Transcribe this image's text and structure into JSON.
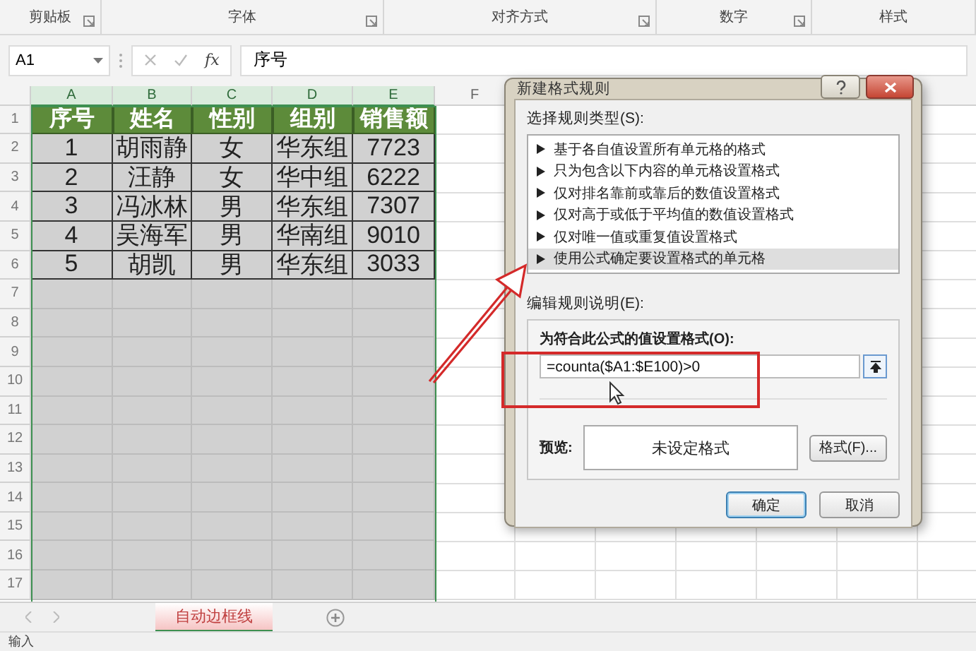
{
  "ribbon": {
    "groups": [
      {
        "label": "剪贴板"
      },
      {
        "label": "字体"
      },
      {
        "label": "对齐方式"
      },
      {
        "label": "数字"
      },
      {
        "label": "样式"
      }
    ]
  },
  "formula_bar": {
    "name_box": "A1",
    "function_label": "fx",
    "value": "序号"
  },
  "sheet": {
    "columns": [
      {
        "label": "A",
        "selected": true
      },
      {
        "label": "B",
        "selected": true
      },
      {
        "label": "C",
        "selected": true
      },
      {
        "label": "D",
        "selected": true
      },
      {
        "label": "E",
        "selected": true
      },
      {
        "label": "F",
        "selected": false
      }
    ],
    "row_numbers": [
      "1",
      "2",
      "3",
      "4",
      "5",
      "6",
      "7",
      "8",
      "9",
      "10",
      "11",
      "12",
      "13",
      "14",
      "15",
      "16",
      "17"
    ],
    "header": [
      "序号",
      "姓名",
      "性别",
      "组别",
      "销售额"
    ],
    "rows": [
      [
        "1",
        "胡雨静",
        "女",
        "华东组",
        "7723"
      ],
      [
        "2",
        "汪静",
        "女",
        "华中组",
        "6222"
      ],
      [
        "3",
        "冯冰林",
        "男",
        "华东组",
        "7307"
      ],
      [
        "4",
        "吴海军",
        "男",
        "华南组",
        "9010"
      ],
      [
        "5",
        "胡凯",
        "男",
        "华东组",
        "3033"
      ]
    ]
  },
  "sheet_tabs": [
    {
      "label": "自动边框线",
      "selected": true
    }
  ],
  "status_bar": {
    "mode": "输入"
  },
  "dialog": {
    "title": "新建格式规则",
    "rule_type_label": "选择规则类型(S):",
    "rule_types": [
      {
        "label": "基于各自值设置所有单元格的格式",
        "selected": false
      },
      {
        "label": "只为包含以下内容的单元格设置格式",
        "selected": false
      },
      {
        "label": "仅对排名靠前或靠后的数值设置格式",
        "selected": false
      },
      {
        "label": "仅对高于或低于平均值的数值设置格式",
        "selected": false
      },
      {
        "label": "仅对唯一值或重复值设置格式",
        "selected": false
      },
      {
        "label": "使用公式确定要设置格式的单元格",
        "selected": true
      }
    ],
    "edit_label": "编辑规则说明(E):",
    "formula_label": "为符合此公式的值设置格式(O):",
    "formula": "=counta($A1:$E100)>0",
    "preview_label": "预览:",
    "preview_text": "未设定格式",
    "format_button": "格式(F)...",
    "ok_button": "确定",
    "cancel_button": "取消"
  }
}
